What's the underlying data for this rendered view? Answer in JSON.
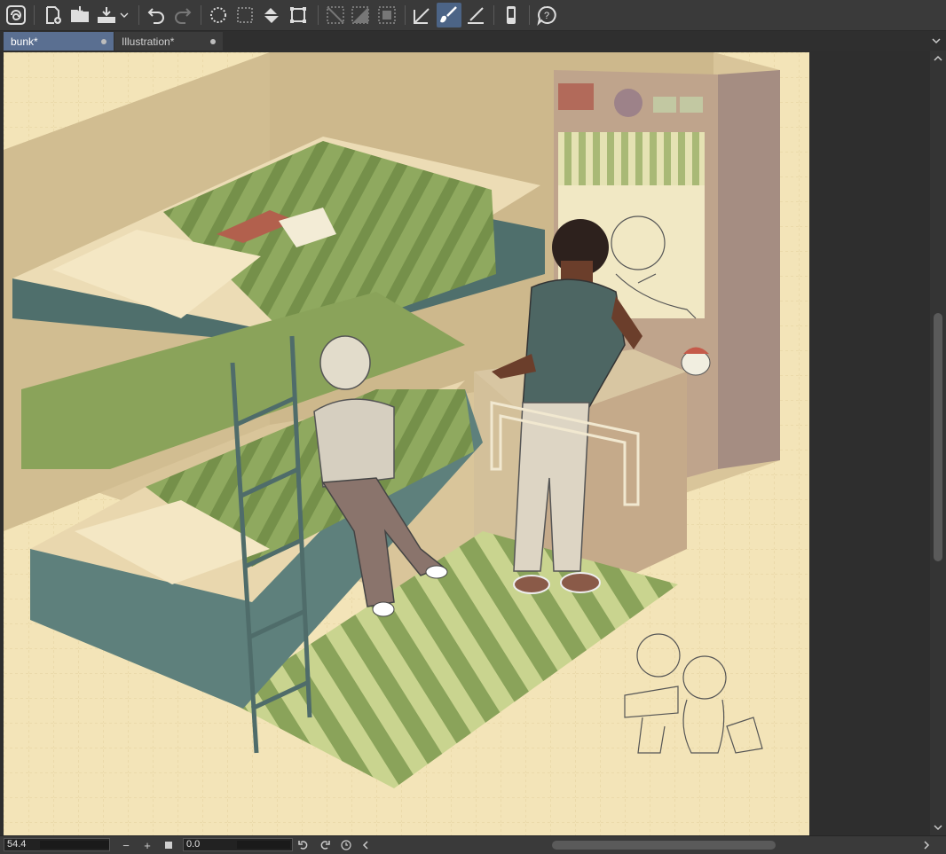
{
  "tabs": [
    {
      "label": "bunk*"
    },
    {
      "label": "Illustration*"
    }
  ],
  "toolbar": {
    "icons": [
      "clip-studio-icon",
      "new-file-icon",
      "open-file-icon",
      "save-icon",
      "undo-icon",
      "redo-icon",
      "select-all-icon",
      "clear-selection-icon",
      "fill-icon",
      "transform-icon",
      "clear-outside-icon",
      "invert-selection-icon",
      "show-selection-icon",
      "pen-tool-icon",
      "brush-tool-icon",
      "ruler-tool-icon",
      "smartphone-icon",
      "help-icon"
    ]
  },
  "status": {
    "zoom": "54.4",
    "angle": "0.0"
  },
  "colors": {
    "accent": "#4c6486",
    "paper": "#f3e4b8",
    "grid": "#e6d2a0"
  }
}
